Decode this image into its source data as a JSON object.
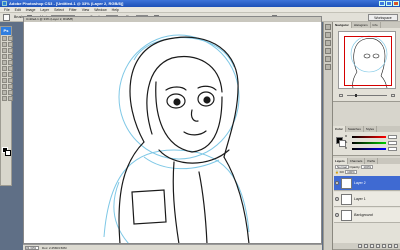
{
  "window": {
    "title": "Adobe Photoshop CS3 - [Untitled-1 @ 33% (Layer 2, RGB/8)]"
  },
  "menu": [
    "File",
    "Edit",
    "Image",
    "Layer",
    "Select",
    "Filter",
    "View",
    "Window",
    "Help"
  ],
  "options": {
    "brush_label": "Brush:",
    "mode_label": "Mode:",
    "mode_value": "Normal",
    "opacity_label": "Opacity:",
    "opacity_value": "100%",
    "flow_label": "Flow:",
    "flow_value": "100%",
    "workspace_label": "Workspace"
  },
  "toolbox": {
    "badge": "Ps"
  },
  "document": {
    "title": "Untitled-1 @ 33% (Layer 2, RGB/8)"
  },
  "status": {
    "zoom": "33.33%",
    "info": "Doc: 2.25M/4.50M"
  },
  "navigator": {
    "tabs": [
      "Navigator",
      "Histogram",
      "Info"
    ],
    "zoom": "33.33%"
  },
  "color_panel": {
    "tabs": [
      "Color",
      "Swatches",
      "Styles"
    ],
    "channels": [
      "R",
      "G",
      "B"
    ]
  },
  "layers_panel": {
    "tabs": [
      "Layers",
      "Channels",
      "Paths"
    ],
    "blend_mode": "Normal",
    "opacity_label": "Opacity:",
    "opacity_value": "100%",
    "fill_label": "Fill:",
    "fill_value": "100%",
    "layers": [
      "Layer 2",
      "Layer 1",
      "Background"
    ],
    "selected_layer": "Layer 2"
  },
  "colors": {
    "titlebar": "#1d50b8",
    "selection": "#3f6ad2",
    "sketch_blue": "#7fc8e6",
    "ink": "#1a1a1a",
    "nav_frame": "#d40000"
  }
}
